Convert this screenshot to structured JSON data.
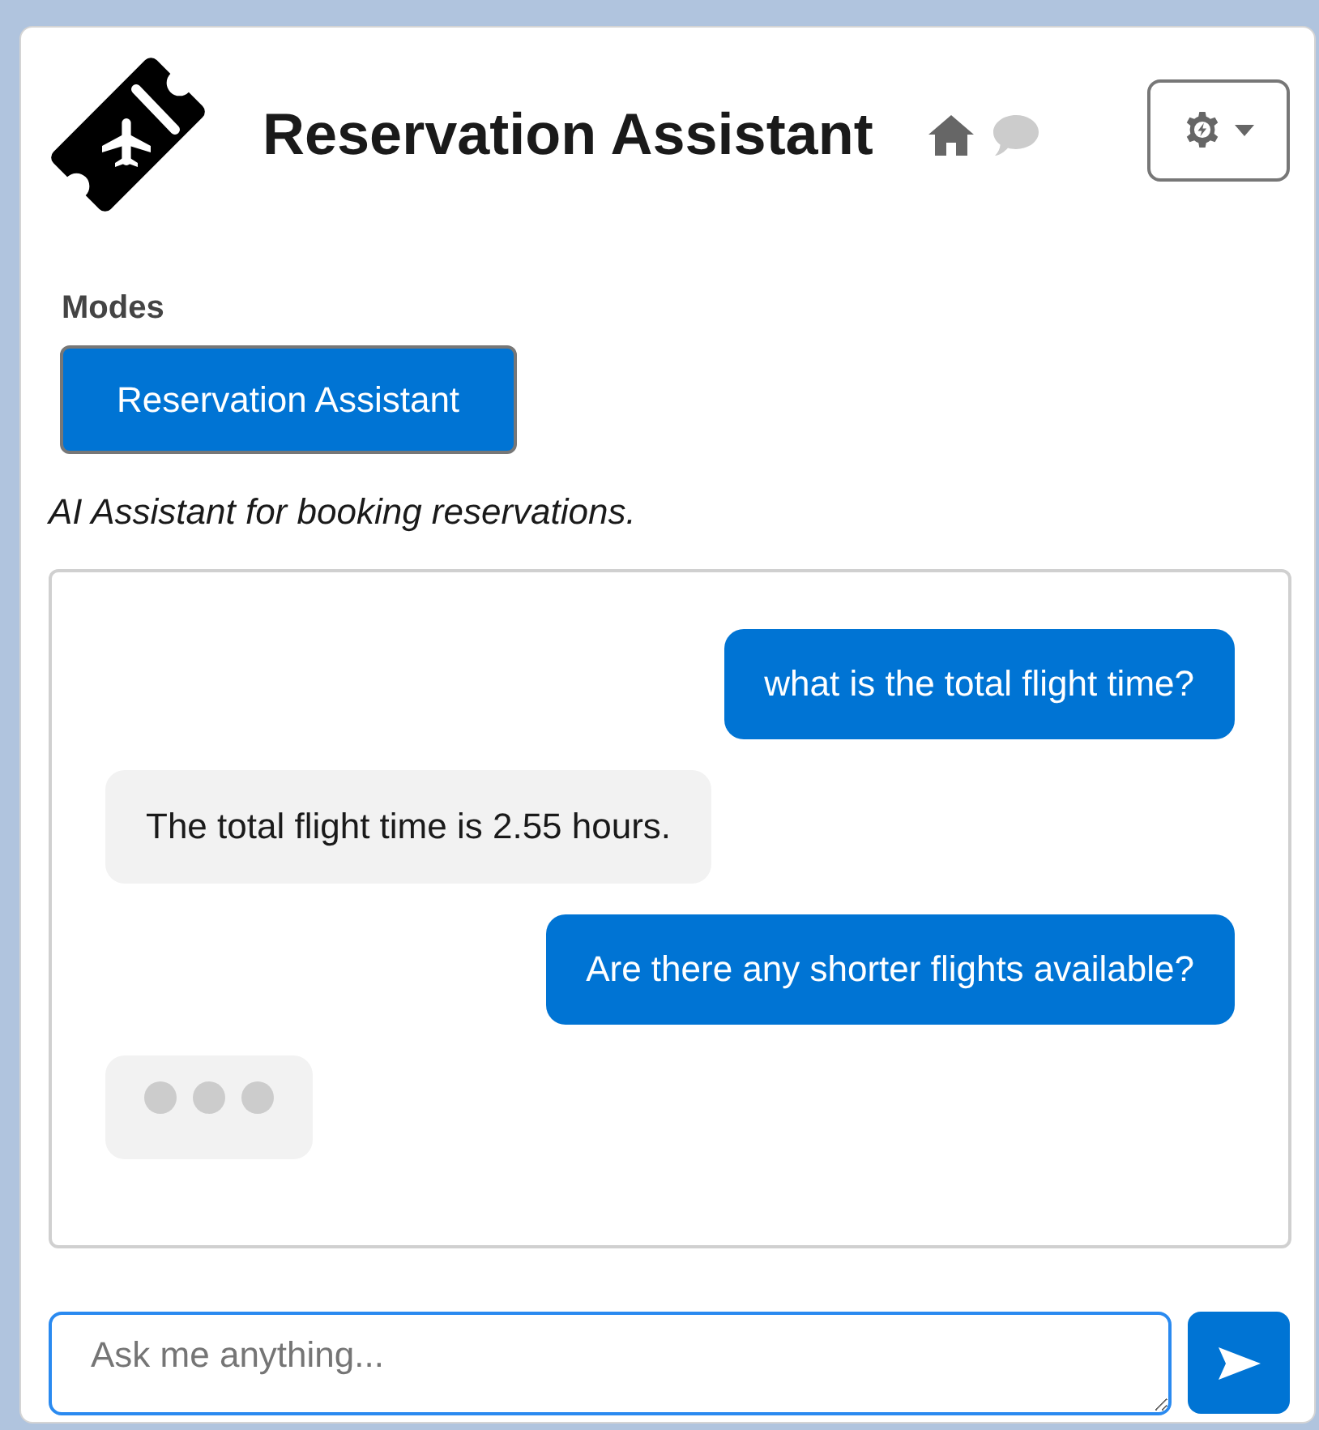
{
  "header": {
    "title": "Reservation Assistant",
    "nav": [
      {
        "kind": "home",
        "selected": true
      },
      {
        "kind": "chat",
        "selected": false
      }
    ]
  },
  "modes": {
    "label": "Modes",
    "items": [
      {
        "label": "Reservation Assistant",
        "selected": true
      }
    ]
  },
  "description": "AI Assistant for booking reservations.",
  "messages": [
    {
      "kind": "user",
      "text": "what is the total flight time?"
    },
    {
      "kind": "assistant",
      "text": "The total flight time is 2.55 hours."
    },
    {
      "kind": "user",
      "text": "Are there any shorter flights available?"
    },
    {
      "kind": "typing"
    }
  ],
  "composer": {
    "placeholder": "Ask me anything..."
  }
}
